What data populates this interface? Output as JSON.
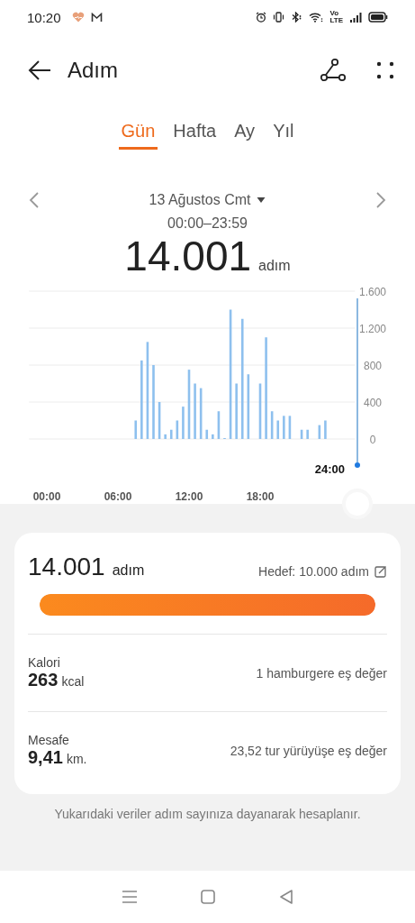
{
  "status_bar": {
    "time": "10:20",
    "volte": [
      "Vo",
      "LTE"
    ]
  },
  "app_bar": {
    "title": "Adım"
  },
  "tabs": [
    {
      "label": "Gün",
      "selected": true
    },
    {
      "label": "Hafta",
      "selected": false
    },
    {
      "label": "Ay",
      "selected": false
    },
    {
      "label": "Yıl",
      "selected": false
    }
  ],
  "date_nav": {
    "date": "13 Ağustos Cmt",
    "range": "00:00–23:59"
  },
  "total": {
    "value": "14.001",
    "unit": "adım"
  },
  "chart": {
    "cursor_label": "24:00",
    "chart_data": {
      "type": "bar",
      "x": [
        7.5,
        8,
        8.5,
        9,
        9.5,
        10,
        10.5,
        11,
        11.5,
        12,
        12.5,
        13,
        13.5,
        14,
        14.5,
        15,
        15.5,
        16,
        16.5,
        17,
        17.5,
        18,
        18.5,
        19,
        19.5,
        20,
        20.5,
        21,
        21.5,
        22,
        22.5,
        23,
        23.5
      ],
      "values": [
        200,
        850,
        1050,
        800,
        400,
        50,
        100,
        200,
        350,
        750,
        600,
        550,
        100,
        50,
        300,
        0,
        1400,
        600,
        1300,
        700,
        null,
        600,
        1100,
        300,
        200,
        250,
        250,
        null,
        100,
        100,
        null,
        150,
        200
      ],
      "xlim": [
        -1.5,
        26
      ],
      "ylim": [
        0,
        1600
      ],
      "grid": true,
      "xticks": [
        {
          "value": 0,
          "label": "00:00"
        },
        {
          "value": 6,
          "label": "06:00"
        },
        {
          "value": 12,
          "label": "12:00"
        },
        {
          "value": 18,
          "label": "18:00"
        }
      ],
      "yticks": [
        {
          "value": 0,
          "label": "0"
        },
        {
          "value": 400,
          "label": "400"
        },
        {
          "value": 800,
          "label": "800"
        },
        {
          "value": 1200,
          "label": "1.200"
        },
        {
          "value": 1600,
          "label": "1.600"
        }
      ]
    }
  },
  "summary": {
    "steps": "14.001",
    "steps_unit": "adım",
    "goal": "Hedef: 10.000 adım",
    "level": 1,
    "rows": [
      {
        "label": "Kalori",
        "value": "263",
        "unit": "kcal",
        "note": "1 hamburgere eş değer"
      },
      {
        "label": "Mesafe",
        "value": "9,41",
        "unit": "km.",
        "note": "23,52 tur yürüyüşe eş değer"
      }
    ]
  },
  "footnote": "Yukarıdaki veriler adım sayınıza dayanarak hesaplanır."
}
